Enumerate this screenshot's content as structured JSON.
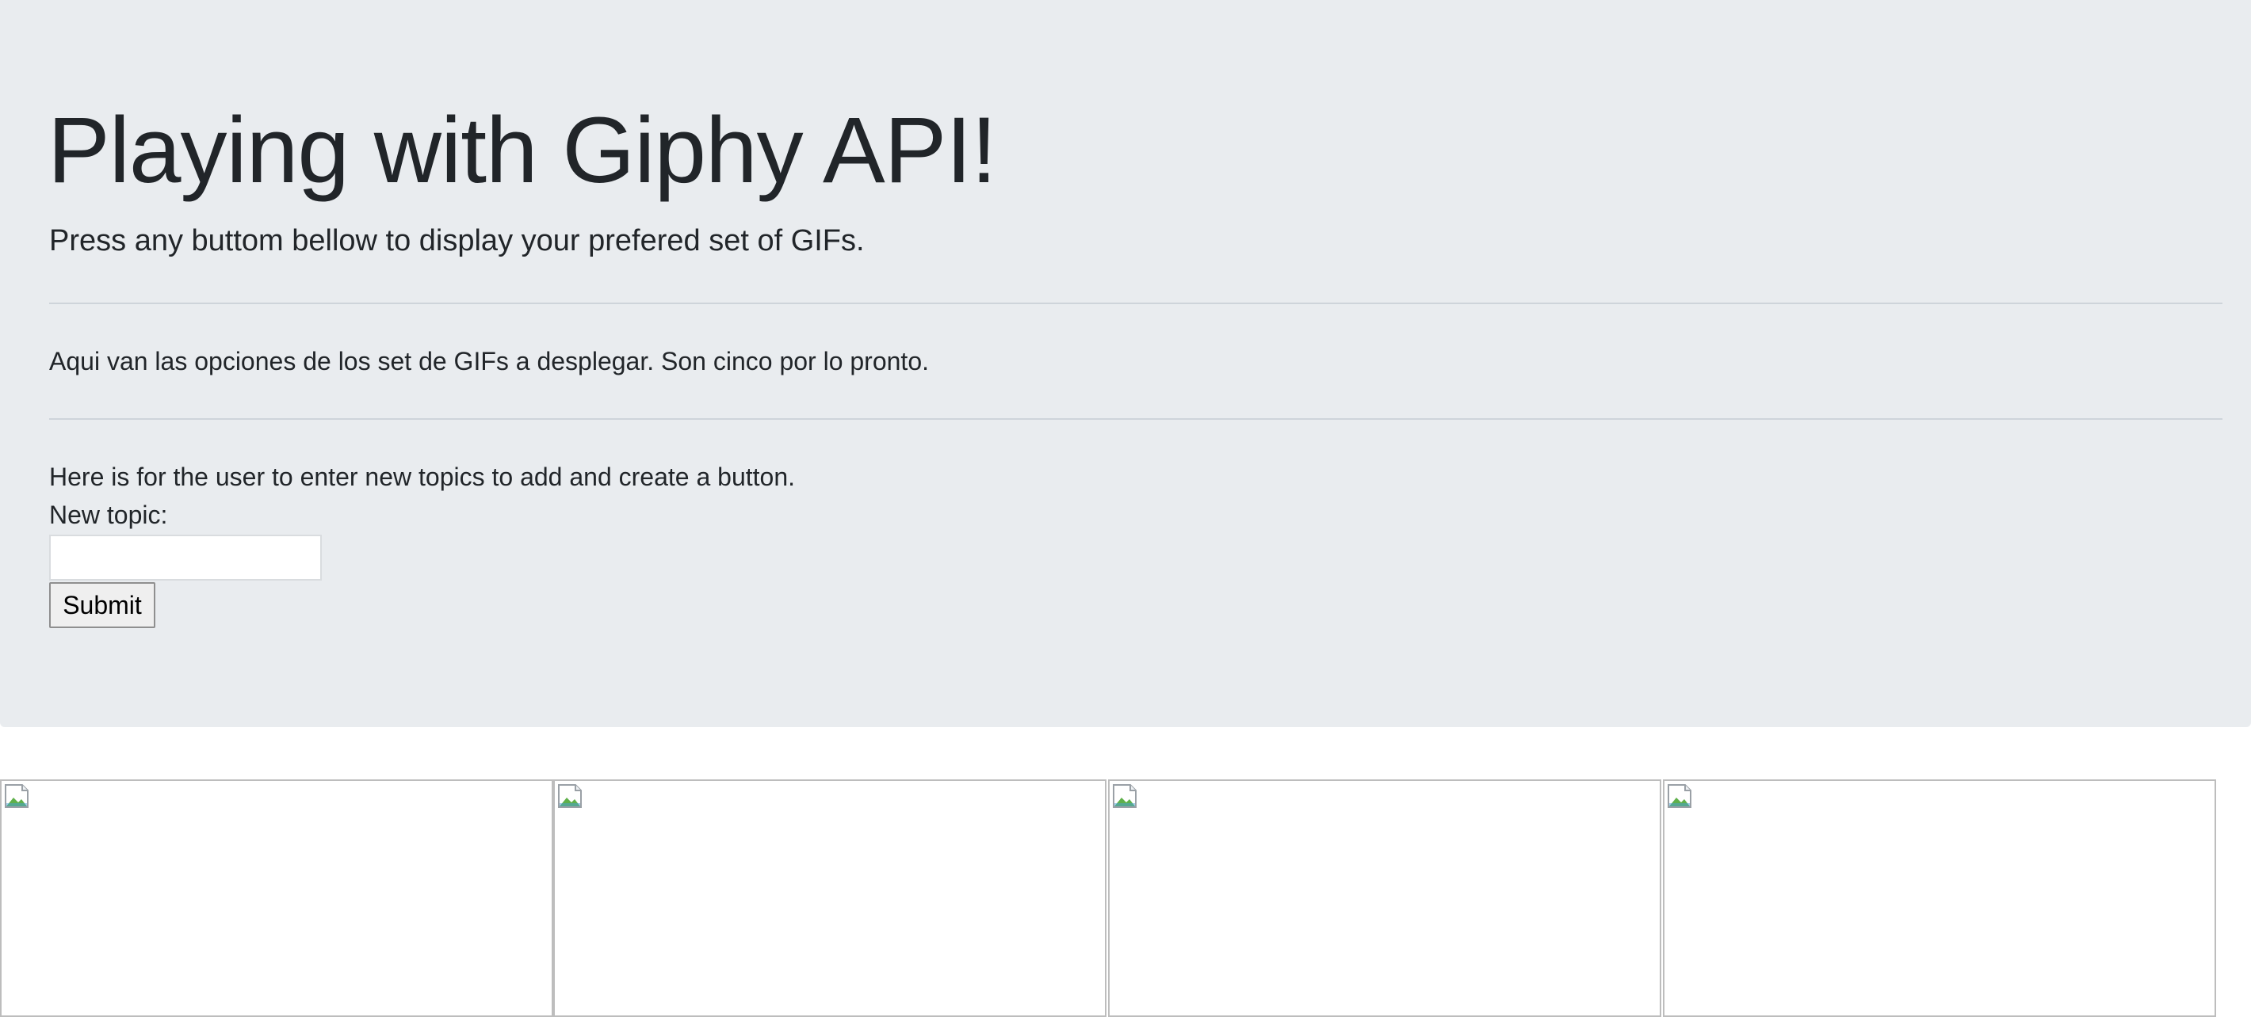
{
  "jumbotron": {
    "title": "Playing with Giphy API!",
    "lead": "Press any buttom bellow to display your prefered set of GIFs.",
    "options_text": "Aqui van las opciones de los set de GIFs a desplegar. Son cinco por lo pronto.",
    "instruction_text": "Here is for the user to enter new topics to add and create a button.",
    "form": {
      "label": "New topic:",
      "input_value": "",
      "input_placeholder": "",
      "submit_label": "Submit"
    }
  },
  "gifs": {
    "icon": "broken-image-icon",
    "count": 4
  },
  "colors": {
    "jumbotron_bg": "#e9ecef",
    "text": "#212529",
    "divider": "#ced4da"
  }
}
